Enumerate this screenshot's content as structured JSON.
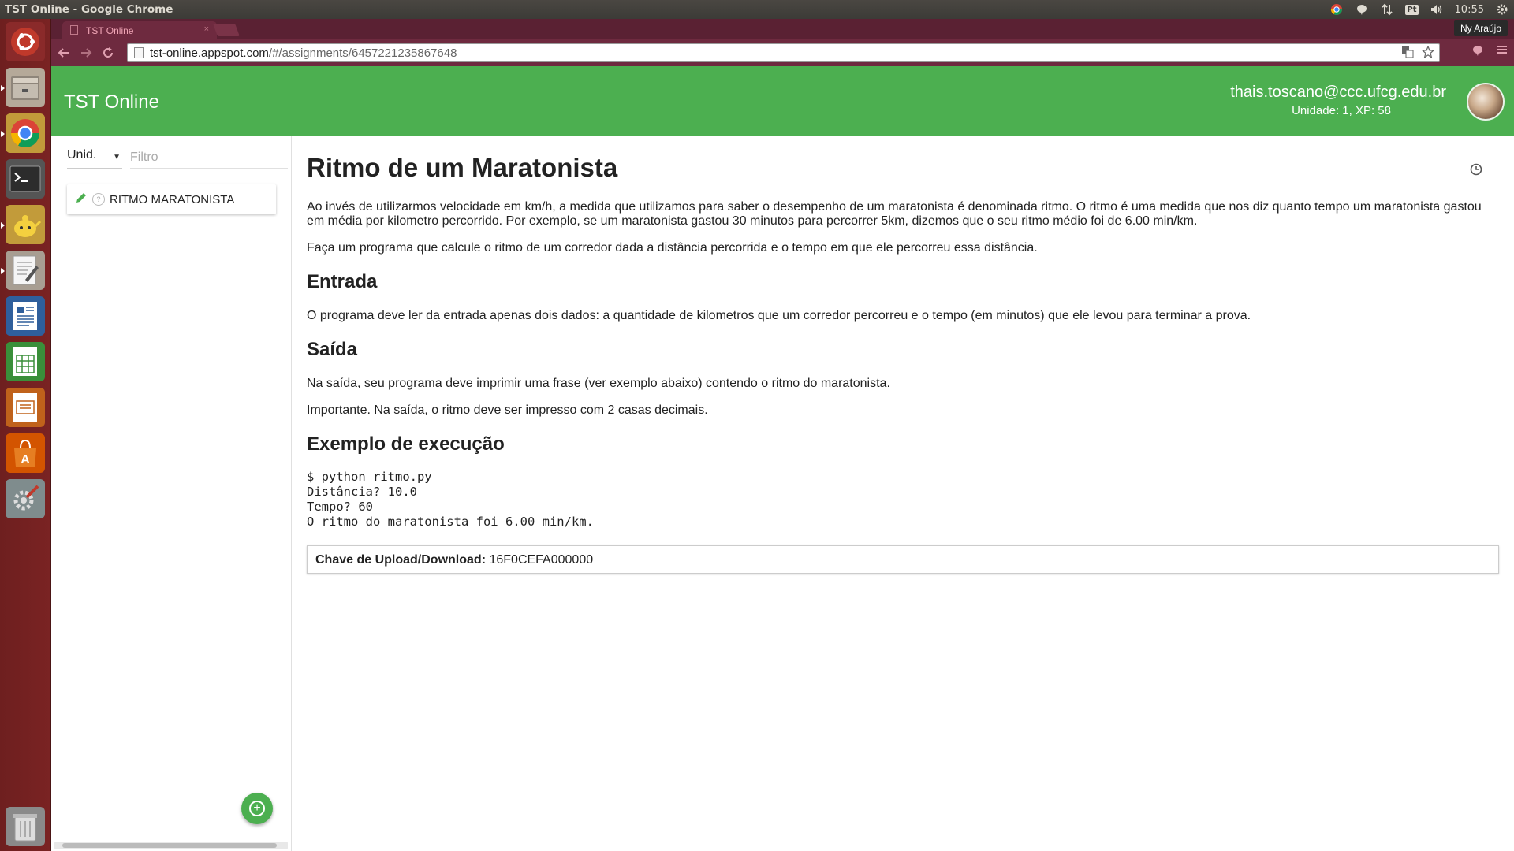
{
  "os_panel": {
    "window_title": "TST Online - Google Chrome",
    "language_indicator": "Pt",
    "clock": "10:55"
  },
  "browser": {
    "tab_title": "TST Online",
    "tab_close": "×",
    "profile_name": "Ny Araújo",
    "url_host": "tst-online.appspot.com",
    "url_path": "/#/assignments/6457221235867648"
  },
  "header": {
    "app_title": "TST Online",
    "user_email": "thais.toscano@ccc.ufcg.edu.br",
    "user_stats": "Unidade: 1, XP: 58"
  },
  "sidebar": {
    "unit_select_value": "Unid.",
    "filter_placeholder": "Filtro",
    "assignments": [
      {
        "title": "RITMO MARATONISTA",
        "status_label": "?"
      }
    ],
    "add_label": "+"
  },
  "assignment": {
    "title": "Ritmo de um Maratonista",
    "intro_p1": "Ao invés de utilizarmos velocidade em km/h, a medida que utilizamos para saber o desempenho de um maratonista é denominada ritmo. O ritmo é uma medida que nos diz quanto tempo um maratonista gastou em média por kilometro percorrido. Por exemplo, se um maratonista gastou 30 minutos para percorrer 5km, dizemos que o seu ritmo médio foi de 6.00 min/km.",
    "intro_p2": "Faça um programa que calcule o ritmo de um corredor dada a distância percorrida e o tempo em que ele percorreu essa distância.",
    "entrada_heading": "Entrada",
    "entrada_text": "O programa deve ler da entrada apenas dois dados: a quantidade de kilometros que um corredor percorreu e o tempo (em minutos) que ele levou para terminar a prova.",
    "saida_heading": "Saída",
    "saida_text": "Na saída, seu programa deve imprimir uma frase (ver exemplo abaixo) contendo o ritmo do maratonista.",
    "saida_note": "Importante. Na saída, o ritmo deve ser impresso com 2 casas decimais.",
    "exemplo_heading": "Exemplo de execução",
    "code_example": "$ python ritmo.py\nDistância? 10.0\nTempo? 60\nO ritmo do maratonista foi 6.00 min/km.",
    "key_label": "Chave de Upload/Download:",
    "key_value": "16F0CEFA000000"
  },
  "colors": {
    "header_green": "#4caf50",
    "launcher_red": "#7a2323",
    "chrome_tab_bar": "#5a2133"
  },
  "icons": [
    "ubuntu-dash-icon",
    "files-icon",
    "chrome-icon",
    "terminal-icon",
    "teapot-icon",
    "text-editor-icon",
    "writer-icon",
    "calc-icon",
    "impress-icon",
    "software-center-icon",
    "settings-icon",
    "trash-icon",
    "pencil-icon",
    "history-icon",
    "add-icon"
  ]
}
